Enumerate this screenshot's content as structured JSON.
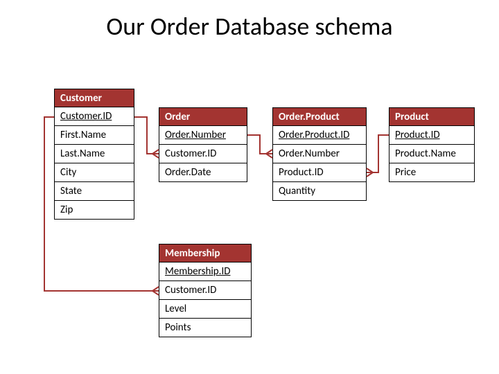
{
  "title": "Our Order Database schema",
  "tables": {
    "customer": {
      "header": "Customer",
      "rows": [
        "Customer.ID",
        "First.Name",
        "Last.Name",
        "City",
        "State",
        "Zip"
      ]
    },
    "order": {
      "header": "Order",
      "rows": [
        "Order.Number",
        "Customer.ID",
        "Order.Date"
      ]
    },
    "orderproduct": {
      "header": "Order.Product",
      "rows": [
        "Order.Product.ID",
        "Order.Number",
        "Product.ID",
        "Quantity"
      ]
    },
    "product": {
      "header": "Product",
      "rows": [
        "Product.ID",
        "Product.Name",
        "Price"
      ]
    },
    "membership": {
      "header": "Membership",
      "rows": [
        "Membership.ID",
        "Customer.ID",
        "Level",
        "Points"
      ]
    }
  },
  "chart_data": {
    "type": "table",
    "title": "Our Order Database schema",
    "entities": [
      {
        "name": "Customer",
        "primary_key": "Customer.ID",
        "columns": [
          "Customer.ID",
          "First.Name",
          "Last.Name",
          "City",
          "State",
          "Zip"
        ]
      },
      {
        "name": "Order",
        "primary_key": "Order.Number",
        "columns": [
          "Order.Number",
          "Customer.ID",
          "Order.Date"
        ]
      },
      {
        "name": "Order.Product",
        "primary_key": "Order.Product.ID",
        "columns": [
          "Order.Product.ID",
          "Order.Number",
          "Product.ID",
          "Quantity"
        ]
      },
      {
        "name": "Product",
        "primary_key": "Product.ID",
        "columns": [
          "Product.ID",
          "Product.Name",
          "Price"
        ]
      },
      {
        "name": "Membership",
        "primary_key": "Membership.ID",
        "columns": [
          "Membership.ID",
          "Customer.ID",
          "Level",
          "Points"
        ]
      }
    ],
    "relationships": [
      {
        "from": "Customer.Customer.ID",
        "to": "Order.Customer.ID"
      },
      {
        "from": "Customer.Customer.ID",
        "to": "Membership.Customer.ID"
      },
      {
        "from": "Order.Order.Number",
        "to": "Order.Product.Order.Number"
      },
      {
        "from": "Product.Product.ID",
        "to": "Order.Product.Product.ID"
      }
    ]
  }
}
